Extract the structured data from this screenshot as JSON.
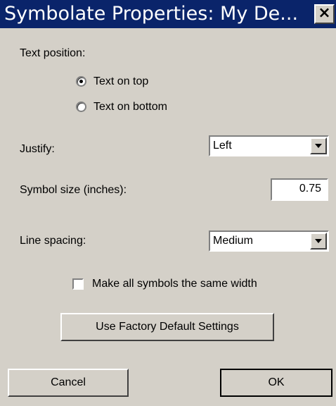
{
  "window": {
    "title": "Symbolate Properties: My De...",
    "close_label": "×"
  },
  "text_position": {
    "label": "Text position:",
    "options": [
      {
        "label": "Text on top",
        "selected": true
      },
      {
        "label": "Text on bottom",
        "selected": false
      }
    ]
  },
  "justify": {
    "label": "Justify:",
    "value": "Left"
  },
  "symbol_size": {
    "label": "Symbol size (inches):",
    "value": "0.75"
  },
  "line_spacing": {
    "label": "Line spacing:",
    "value": "Medium"
  },
  "same_width": {
    "label": "Make all symbols the same width",
    "checked": false
  },
  "buttons": {
    "factory_default": "Use Factory Default Settings",
    "cancel": "Cancel",
    "ok": "OK"
  },
  "icons": {
    "close": "close-icon",
    "dropdown": "chevron-down-icon"
  },
  "colors": {
    "titlebar": "#0a246a",
    "dialog_bg": "#d4d0c8"
  }
}
